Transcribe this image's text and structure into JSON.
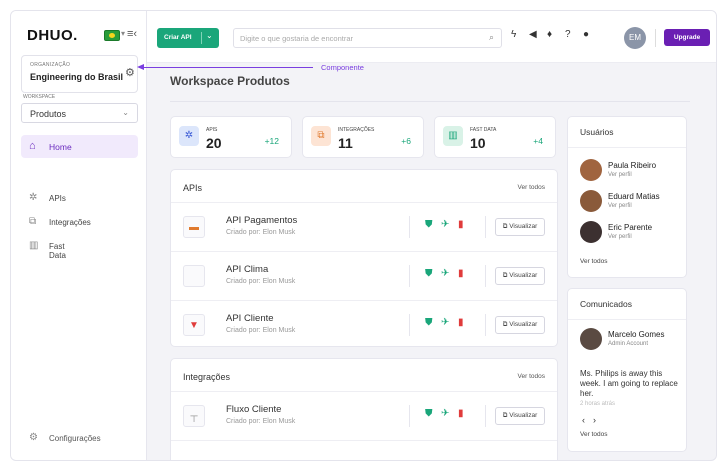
{
  "sidebar": {
    "logo": "DHUO.",
    "org_label": "ORGANIZAÇÃO",
    "org_name": "Engineering do Brasil",
    "workspace_label": "WORKSPACE",
    "workspace_value": "Produtos",
    "home_label": "Home",
    "items": [
      {
        "label": "APIs"
      },
      {
        "label": "Integrações"
      },
      {
        "label": "Fast Data"
      }
    ],
    "config_label": "Configurações"
  },
  "annotation": {
    "label": "Componente"
  },
  "topbar": {
    "create_label": "Criar API",
    "search_placeholder": "Digite o que gostaria de encontrar",
    "avatar_initials": "EM",
    "upgrade_label": "Upgrade"
  },
  "main": {
    "title": "Workspace Produtos",
    "stats": [
      {
        "label": "APIS",
        "value": "20",
        "delta": "+12"
      },
      {
        "label": "INTEGRAÇÕES",
        "value": "11",
        "delta": "+6"
      },
      {
        "label": "FAST DATA",
        "value": "10",
        "delta": "+4"
      }
    ],
    "apis": {
      "title": "APIs",
      "see_all": "Ver todos",
      "rows": [
        {
          "name": "API Pagamentos",
          "sub": "Criado por: Elon Musk"
        },
        {
          "name": "API Clima",
          "sub": "Criado por: Elon Musk"
        },
        {
          "name": "API Cliente",
          "sub": "Criado por: Elon Musk"
        }
      ]
    },
    "integrations": {
      "title": "Integrações",
      "see_all": "Ver todos",
      "rows": [
        {
          "name": "Fluxo Cliente",
          "sub": "Criado por: Elon Musk"
        }
      ]
    },
    "view_label": "Visualizar"
  },
  "users": {
    "title": "Usuários",
    "list": [
      {
        "name": "Paula Ribeiro",
        "sub": "Ver perfil"
      },
      {
        "name": "Eduard Matias",
        "sub": "Ver perfil"
      },
      {
        "name": "Eric Parente",
        "sub": "Ver perfil"
      }
    ],
    "see_all": "Ver todos"
  },
  "announcements": {
    "title": "Comunicados",
    "author": "Marcelo Gomes",
    "role": "Admin Account",
    "message": "Ms. Philips is away this week. I am going to replace her.",
    "time": "2 horas atrás",
    "see_all": "Ver todos"
  },
  "colors": {
    "accent": "#6a1fb3",
    "primary_green": "#1aa67a"
  }
}
